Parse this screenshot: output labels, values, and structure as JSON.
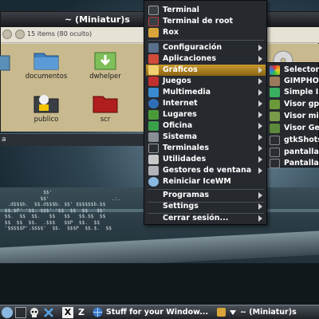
{
  "file_manager": {
    "title": "~ (Miniatur)s",
    "items_count": "15 items (80 oculto)",
    "items": [
      {
        "label": "",
        "icon": "folder-icon"
      },
      {
        "label": "documentos",
        "icon": "folder-icon"
      },
      {
        "label": "dwhelper",
        "icon": "download-folder-icon"
      },
      {
        "label": "publico",
        "icon": "public-folder-icon"
      },
      {
        "label": "scr",
        "icon": "red-folder-icon"
      },
      {
        "label": "",
        "icon": "cdrom-icon"
      }
    ]
  },
  "terminal": {
    "title": "a"
  },
  "ascii_art": "              $$'                                                    \n             $$'                     .:.                  \n  .d$$$b.  $$.d$$$b. $$' $$$$$$b.$$ \n $$.$P' '$$. $$$' '$$  $$  $$   $$'\n $$.  $$  $$.   $$   $$   $$.$$  $$\n $$  $$  $$.  .$$$   $$P  $$.  $$\n '$$$$$P'.$$$$'  $$.  $$$P  $$.$.  $$",
  "main_menu": {
    "items": [
      {
        "label": "Terminal",
        "icon": "terminal-icon",
        "has_submenu": false
      },
      {
        "label": "Terminal de root",
        "icon": "root-terminal-icon",
        "has_submenu": false
      },
      {
        "label": "Rox",
        "icon": "rox-filer-icon",
        "has_submenu": false
      },
      {
        "label": "Configuración",
        "icon": "settings-icon",
        "has_submenu": true
      },
      {
        "label": "Aplicaciones",
        "icon": "applications-icon",
        "has_submenu": true
      },
      {
        "label": "Gráficos",
        "icon": "graphics-icon",
        "has_submenu": true,
        "active": true
      },
      {
        "label": "Juegos",
        "icon": "games-icon",
        "has_submenu": true
      },
      {
        "label": "Multimedia",
        "icon": "multimedia-icon",
        "has_submenu": true
      },
      {
        "label": "Internet",
        "icon": "internet-icon",
        "has_submenu": true
      },
      {
        "label": "Lugares",
        "icon": "places-icon",
        "has_submenu": true
      },
      {
        "label": "Oficina",
        "icon": "office-icon",
        "has_submenu": true
      },
      {
        "label": "Sistema",
        "icon": "system-icon",
        "has_submenu": true
      },
      {
        "label": "Terminales",
        "icon": "terminals-icon",
        "has_submenu": true
      },
      {
        "label": "Utilidades",
        "icon": "utilities-icon",
        "has_submenu": true
      },
      {
        "label": "Gestores de ventana",
        "icon": "window-managers-icon",
        "has_submenu": true
      },
      {
        "label": "Reiniciar IceWM",
        "icon": "restart-icon",
        "has_submenu": false
      },
      {
        "label": "Programas",
        "icon": "",
        "has_submenu": true
      },
      {
        "label": "Settings",
        "icon": "",
        "has_submenu": true
      },
      {
        "label": "Cerrar sesión...",
        "icon": "",
        "has_submenu": true
      }
    ]
  },
  "sub_menu": {
    "items": [
      {
        "label": "Selector",
        "icon": "color-selector-icon"
      },
      {
        "label": "GIMPHOT",
        "icon": "gimphoto-icon"
      },
      {
        "label": "Simple In",
        "icon": "image-icon"
      },
      {
        "label": "Visor gpi",
        "icon": "viewer-icon"
      },
      {
        "label": "Visor mir",
        "icon": "viewer-icon"
      },
      {
        "label": "Visor Geo",
        "icon": "viewer-icon"
      },
      {
        "label": "gtkShots",
        "icon": "screenshot-icon"
      },
      {
        "label": "pantallaz",
        "icon": "screenshot-icon"
      },
      {
        "label": "Pantallaz",
        "icon": "screenshot-icon"
      }
    ]
  },
  "taskbar": {
    "close_symbol": "X",
    "z_label": "Z",
    "task1": "Stuff for your Window...",
    "task2": "~ (Miniatur)s"
  },
  "colors": {
    "menu_bg": "#262a2f",
    "menu_active": "#b5861f",
    "fm_content_bg": "#c8b98e"
  }
}
